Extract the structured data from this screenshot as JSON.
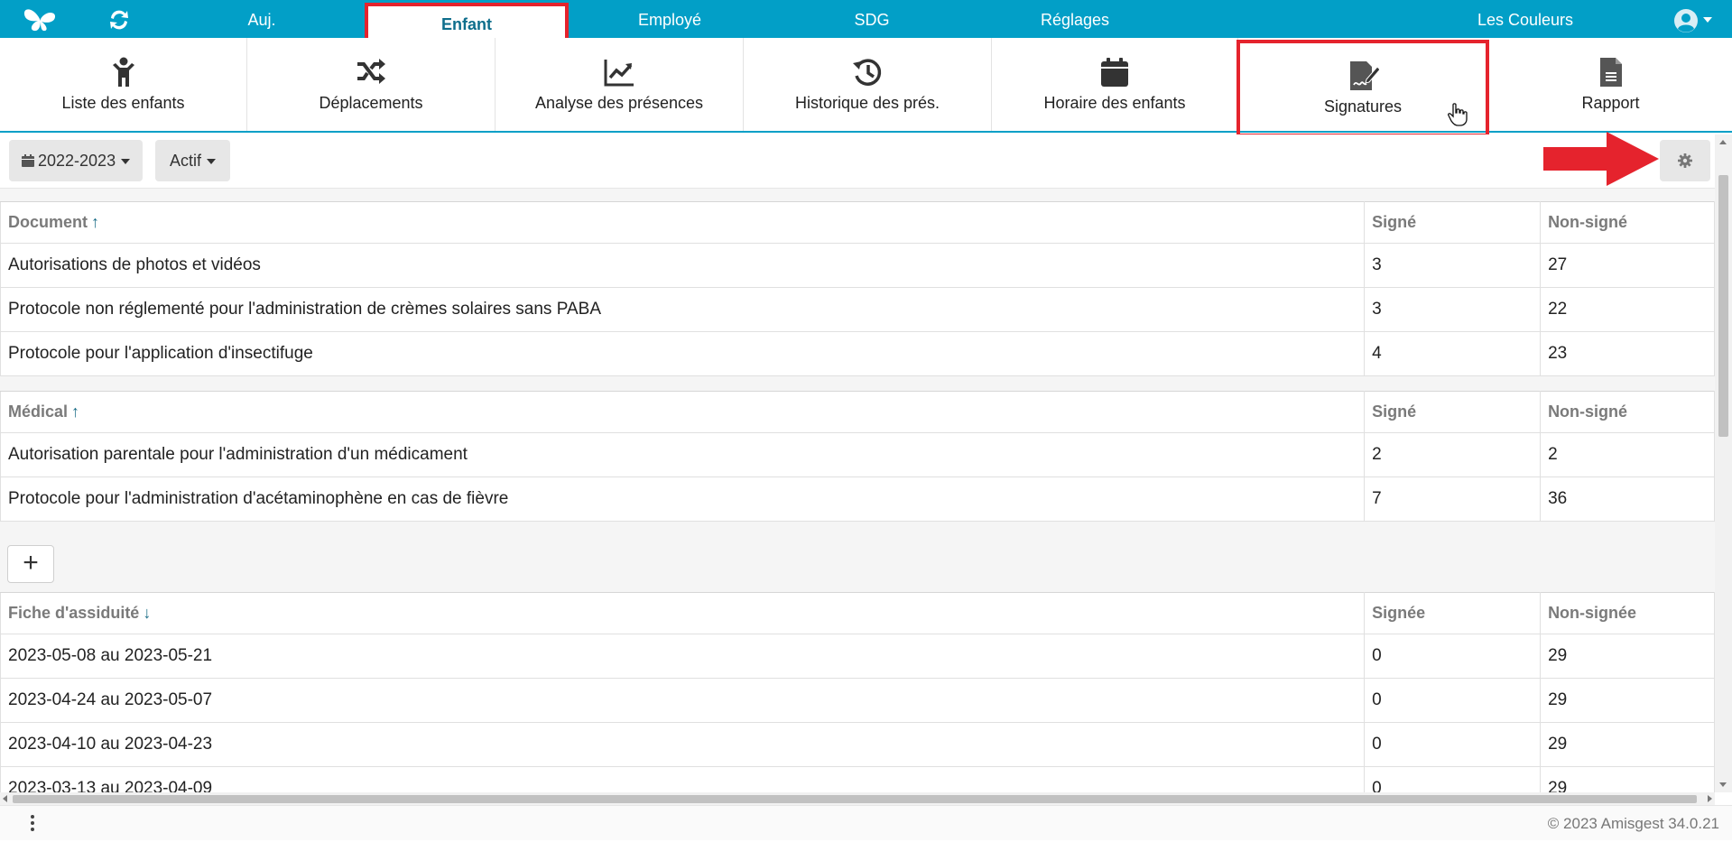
{
  "topnav": {
    "items": [
      {
        "label": "Auj."
      },
      {
        "label": "Enfant"
      },
      {
        "label": "Employé"
      },
      {
        "label": "SDG"
      },
      {
        "label": "Réglages"
      }
    ],
    "active": "Enfant",
    "organization": "Les Couleurs",
    "colors": {
      "bar": "#029fc7",
      "highlight": "#e5232d"
    }
  },
  "subnav": {
    "items": [
      {
        "label": "Liste des enfants",
        "icon": "child-icon"
      },
      {
        "label": "Déplacements",
        "icon": "shuffle-icon"
      },
      {
        "label": "Analyse des présences",
        "icon": "trend-chart-icon"
      },
      {
        "label": "Historique des prés.",
        "icon": "history-icon"
      },
      {
        "label": "Horaire des enfants",
        "icon": "calendar-icon"
      },
      {
        "label": "Signatures",
        "icon": "signature-icon"
      },
      {
        "label": "Rapport",
        "icon": "report-icon"
      }
    ],
    "highlighted": "Signatures"
  },
  "toolbar": {
    "year": "2022-2023",
    "status": "Actif"
  },
  "documents": {
    "headers": [
      "Document",
      "Signé",
      "Non-signé"
    ],
    "sort": "asc",
    "rows": [
      [
        "Autorisations de photos et vidéos",
        "3",
        "27"
      ],
      [
        "Protocole non réglementé pour l'administration de crèmes solaires sans PABA",
        "3",
        "22"
      ],
      [
        "Protocole pour l'application d'insectifuge",
        "4",
        "23"
      ]
    ]
  },
  "medical": {
    "headers": [
      "Médical",
      "Signé",
      "Non-signé"
    ],
    "sort": "asc",
    "rows": [
      [
        "Autorisation parentale pour l'administration d'un médicament",
        "2",
        "2"
      ],
      [
        "Protocole pour l'administration d'acétaminophène en cas de fièvre",
        "7",
        "36"
      ]
    ]
  },
  "add_button": "+",
  "attendance": {
    "headers": [
      "Fiche d'assiduité",
      "Signée",
      "Non-signée"
    ],
    "sort": "desc",
    "rows": [
      [
        "2023-05-08 au 2023-05-21",
        "0",
        "29"
      ],
      [
        "2023-04-24 au 2023-05-07",
        "0",
        "29"
      ],
      [
        "2023-04-10 au 2023-04-23",
        "0",
        "29"
      ],
      [
        "2023-03-13 au 2023-04-09",
        "0",
        "29"
      ]
    ]
  },
  "footer": {
    "copyright": "© 2023 Amisgest 34.0.21"
  }
}
